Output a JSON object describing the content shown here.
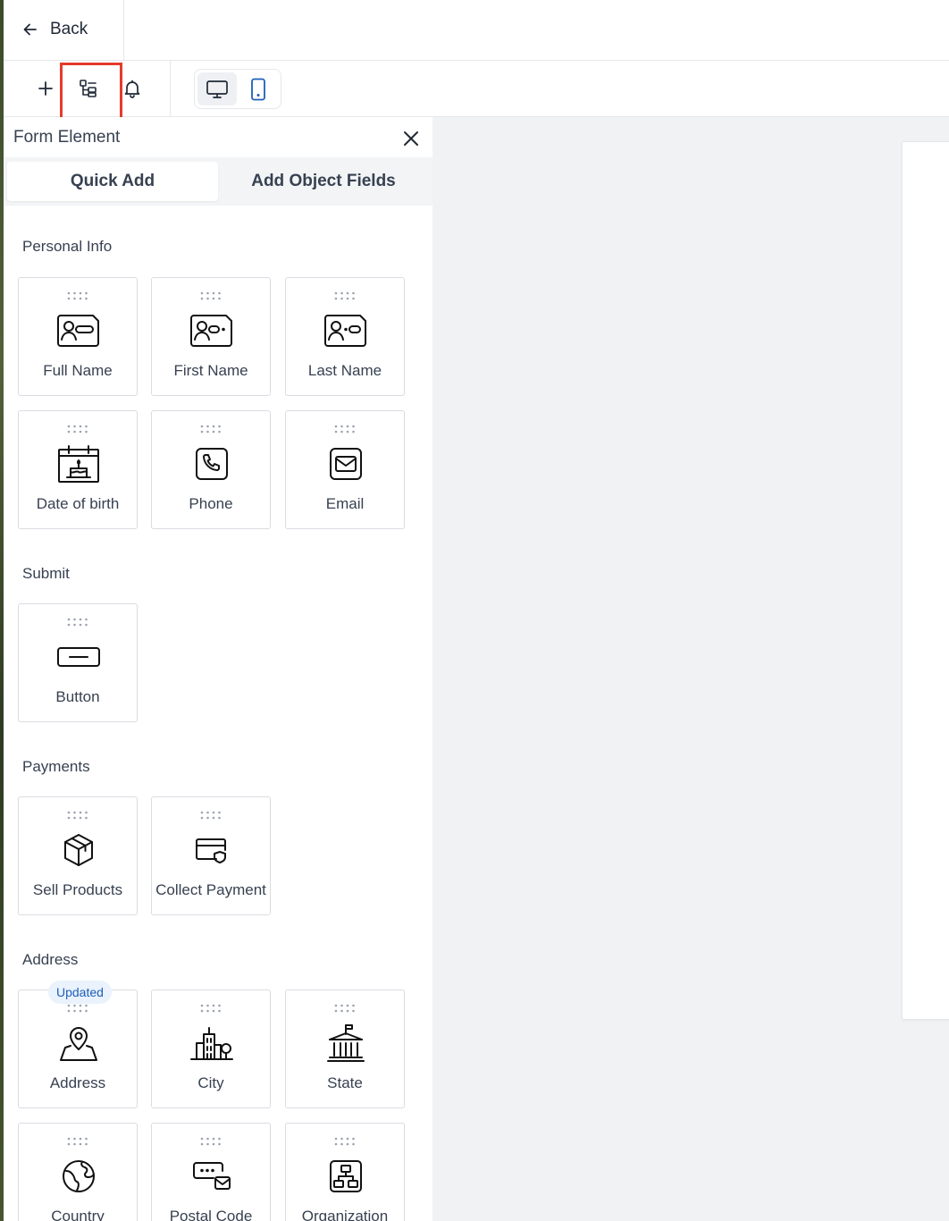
{
  "header": {
    "back_label": "Back"
  },
  "toolbar": {
    "add_icon": "plus-icon",
    "elements_icon": "form-elements-icon",
    "notifications_icon": "bell-icon",
    "devices": [
      {
        "name": "desktop",
        "icon": "desktop-icon",
        "active": true
      },
      {
        "name": "mobile",
        "icon": "mobile-icon",
        "active": false
      }
    ],
    "accent_color": "#1d5fb8",
    "highlight_color": "#e53b2c"
  },
  "panel": {
    "title": "Form Element",
    "tabs": [
      {
        "label": "Quick Add",
        "active": true
      },
      {
        "label": "Add Object Fields",
        "active": false
      }
    ],
    "sections": {
      "personal_info": {
        "label": "Personal Info",
        "items": [
          {
            "label": "Full Name",
            "icon": "id-card-icon"
          },
          {
            "label": "First Name",
            "icon": "id-card-first-icon"
          },
          {
            "label": "Last Name",
            "icon": "id-card-last-icon"
          },
          {
            "label": "Date of birth",
            "icon": "birthday-cake-calendar-icon"
          },
          {
            "label": "Phone",
            "icon": "phone-icon"
          },
          {
            "label": "Email",
            "icon": "envelope-icon"
          }
        ]
      },
      "submit": {
        "label": "Submit",
        "items": [
          {
            "label": "Button",
            "icon": "button-icon"
          }
        ]
      },
      "payments": {
        "label": "Payments",
        "items": [
          {
            "label": "Sell Products",
            "icon": "box-icon"
          },
          {
            "label": "Collect Payment",
            "icon": "card-shield-icon"
          }
        ]
      },
      "address": {
        "label": "Address",
        "badge": "Updated",
        "items": [
          {
            "label": "Address",
            "icon": "map-pin-icon"
          },
          {
            "label": "City",
            "icon": "city-buildings-icon"
          },
          {
            "label": "State",
            "icon": "state-building-icon"
          },
          {
            "label": "Country",
            "icon": "globe-icon"
          },
          {
            "label": "Postal Code",
            "icon": "postal-code-icon"
          },
          {
            "label": "Organization",
            "icon": "organization-icon"
          }
        ]
      }
    }
  }
}
